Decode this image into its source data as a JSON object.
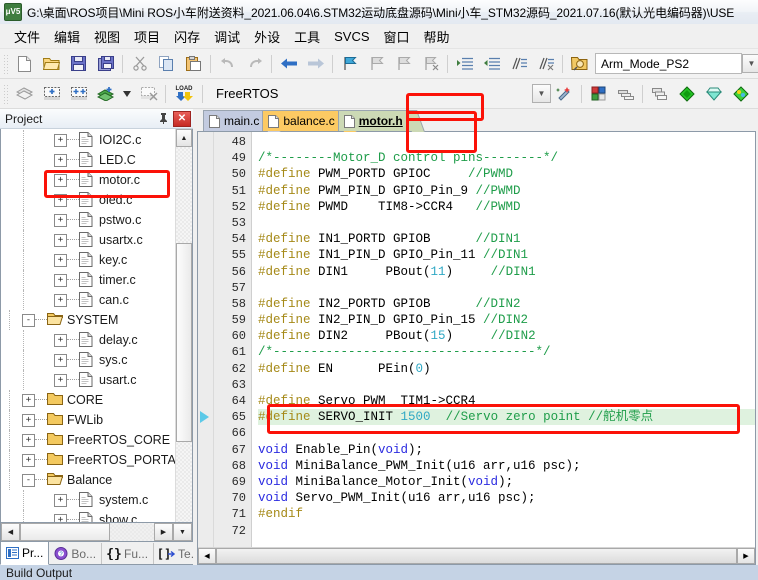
{
  "window": {
    "title": "G:\\桌面\\ROS项目\\Mini ROS小车附送资料_2021.06.04\\6.STM32运动底盘源码\\Mini小车_STM32源码_2021.07.16(默认光电编码器)\\USE",
    "app_icon": "keil-uvision-icon"
  },
  "menubar": {
    "items": [
      {
        "label": "文件",
        "name": "menu-file"
      },
      {
        "label": "编辑",
        "name": "menu-edit"
      },
      {
        "label": "视图",
        "name": "menu-view"
      },
      {
        "label": "项目",
        "name": "menu-project"
      },
      {
        "label": "闪存",
        "name": "menu-flash"
      },
      {
        "label": "调试",
        "name": "menu-debug"
      },
      {
        "label": "外设",
        "name": "menu-peripherals"
      },
      {
        "label": "工具",
        "name": "menu-tools"
      },
      {
        "label": "SVCS",
        "name": "menu-svcs"
      },
      {
        "label": "窗口",
        "name": "menu-window"
      },
      {
        "label": "帮助",
        "name": "menu-help"
      }
    ]
  },
  "toolbar_file": {
    "icons": [
      "new-file-icon",
      "open-folder-icon",
      "save-icon",
      "save-all-icon",
      "cut-icon",
      "copy-icon",
      "paste-icon",
      "undo-icon",
      "redo-icon",
      "navigate-back-icon",
      "navigate-forward-icon",
      "bookmark-toggle-icon",
      "bookmark-prev-icon",
      "bookmark-next-icon",
      "bookmark-clear-icon",
      "indent-icon",
      "outdent-icon",
      "comment-icon",
      "uncomment-icon"
    ],
    "target_label": "Arm_Mode_PS2",
    "right_icons": [
      "target-options-icon",
      "manage-components-icon",
      "debug-icon"
    ]
  },
  "toolbar_build": {
    "icons": [
      "translate-icon",
      "build-icon",
      "rebuild-icon",
      "batch-build-icon",
      "stop-build-icon",
      "download-icon"
    ],
    "target_label": "FreeRTOS",
    "right_icons": [
      "config-wizard-icon",
      "manage-project-icon",
      "multi-project-icon",
      "window-cascade-icon",
      "green-diamond-icon",
      "cyan-diamond-icon",
      "multi-diamond-icon"
    ]
  },
  "project_panel": {
    "title": "Project",
    "pin_icon": "pin-icon",
    "close_icon": "close-icon",
    "tree": [
      {
        "label": "IOI2C.c",
        "indent": 2,
        "type": "file",
        "expander": "+"
      },
      {
        "label": "LED.C",
        "indent": 2,
        "type": "file",
        "expander": "+"
      },
      {
        "label": "motor.c",
        "indent": 2,
        "type": "file",
        "expander": "+",
        "annotated": true
      },
      {
        "label": "oled.c",
        "indent": 2,
        "type": "file",
        "expander": "+"
      },
      {
        "label": "pstwo.c",
        "indent": 2,
        "type": "file",
        "expander": "+"
      },
      {
        "label": "usartx.c",
        "indent": 2,
        "type": "file",
        "expander": "+"
      },
      {
        "label": "key.c",
        "indent": 2,
        "type": "file",
        "expander": "+"
      },
      {
        "label": "timer.c",
        "indent": 2,
        "type": "file",
        "expander": "+"
      },
      {
        "label": "can.c",
        "indent": 2,
        "type": "file",
        "expander": "+"
      },
      {
        "label": "SYSTEM",
        "indent": 1,
        "type": "folder-open",
        "expander": "-"
      },
      {
        "label": "delay.c",
        "indent": 2,
        "type": "file",
        "expander": "+"
      },
      {
        "label": "sys.c",
        "indent": 2,
        "type": "file",
        "expander": "+"
      },
      {
        "label": "usart.c",
        "indent": 2,
        "type": "file",
        "expander": "+"
      },
      {
        "label": "CORE",
        "indent": 1,
        "type": "folder",
        "expander": "+"
      },
      {
        "label": "FWLib",
        "indent": 1,
        "type": "folder",
        "expander": "+"
      },
      {
        "label": "FreeRTOS_CORE",
        "indent": 1,
        "type": "folder",
        "expander": "+"
      },
      {
        "label": "FreeRTOS_PORTABLE",
        "indent": 1,
        "type": "folder",
        "expander": "+"
      },
      {
        "label": "Balance",
        "indent": 1,
        "type": "folder-open",
        "expander": "-"
      },
      {
        "label": "system.c",
        "indent": 2,
        "type": "file",
        "expander": "+"
      },
      {
        "label": "show.c",
        "indent": 2,
        "type": "file",
        "expander": "+"
      }
    ],
    "tabs": [
      {
        "label": "Pr...",
        "name": "panel-tab-project",
        "icon": "project-icon",
        "active": true
      },
      {
        "label": "Bo...",
        "name": "panel-tab-books",
        "icon": "books-icon",
        "active": false
      },
      {
        "label": "Fu...",
        "name": "panel-tab-functions",
        "icon": "braces-icon",
        "active": false
      },
      {
        "label": "Te...",
        "name": "panel-tab-templates",
        "icon": "templates-icon",
        "active": false
      }
    ]
  },
  "editor": {
    "tabs": [
      {
        "label": "main.c",
        "name": "doc-tab-main-c",
        "active": false
      },
      {
        "label": "balance.c",
        "name": "doc-tab-balance-c",
        "active": false
      },
      {
        "label": "motor.h",
        "name": "doc-tab-motor-h",
        "active": true,
        "annotated": true
      }
    ],
    "first_line": 48,
    "lines": [
      {
        "n": 48,
        "tokens": []
      },
      {
        "n": 49,
        "tokens": [
          {
            "t": "com",
            "s": "/*--------Motor_D control pins--------*/"
          }
        ]
      },
      {
        "n": 50,
        "tokens": [
          {
            "t": "pre",
            "s": "#define"
          },
          {
            "t": "pln",
            "s": " PWM_PORTD GPIOC     "
          },
          {
            "t": "com",
            "s": "//PWMD"
          }
        ]
      },
      {
        "n": 51,
        "tokens": [
          {
            "t": "pre",
            "s": "#define"
          },
          {
            "t": "pln",
            "s": " PWM_PIN_D GPIO_Pin_9 "
          },
          {
            "t": "com",
            "s": "//PWMD"
          }
        ]
      },
      {
        "n": 52,
        "tokens": [
          {
            "t": "pre",
            "s": "#define"
          },
          {
            "t": "pln",
            "s": " PWMD    TIM8->CCR4   "
          },
          {
            "t": "com",
            "s": "//PWMD"
          }
        ]
      },
      {
        "n": 53,
        "tokens": []
      },
      {
        "n": 54,
        "tokens": [
          {
            "t": "pre",
            "s": "#define"
          },
          {
            "t": "pln",
            "s": " IN1_PORTD GPIOB      "
          },
          {
            "t": "com",
            "s": "//DIN1"
          }
        ]
      },
      {
        "n": 55,
        "tokens": [
          {
            "t": "pre",
            "s": "#define"
          },
          {
            "t": "pln",
            "s": " IN1_PIN_D GPIO_Pin_11 "
          },
          {
            "t": "com",
            "s": "//DIN1"
          }
        ]
      },
      {
        "n": 56,
        "tokens": [
          {
            "t": "pre",
            "s": "#define"
          },
          {
            "t": "pln",
            "s": " DIN1     PBout("
          },
          {
            "t": "num",
            "s": "11"
          },
          {
            "t": "pln",
            "s": ")     "
          },
          {
            "t": "com",
            "s": "//DIN1"
          }
        ]
      },
      {
        "n": 57,
        "tokens": []
      },
      {
        "n": 58,
        "tokens": [
          {
            "t": "pre",
            "s": "#define"
          },
          {
            "t": "pln",
            "s": " IN2_PORTD GPIOB      "
          },
          {
            "t": "com",
            "s": "//DIN2"
          }
        ]
      },
      {
        "n": 59,
        "tokens": [
          {
            "t": "pre",
            "s": "#define"
          },
          {
            "t": "pln",
            "s": " IN2_PIN_D GPIO_Pin_15 "
          },
          {
            "t": "com",
            "s": "//DIN2"
          }
        ]
      },
      {
        "n": 60,
        "tokens": [
          {
            "t": "pre",
            "s": "#define"
          },
          {
            "t": "pln",
            "s": " DIN2     PBout("
          },
          {
            "t": "num",
            "s": "15"
          },
          {
            "t": "pln",
            "s": ")     "
          },
          {
            "t": "com",
            "s": "//DIN2"
          }
        ]
      },
      {
        "n": 61,
        "tokens": [
          {
            "t": "com",
            "s": "/*-----------------------------------*/"
          }
        ]
      },
      {
        "n": 62,
        "tokens": [
          {
            "t": "pre",
            "s": "#define"
          },
          {
            "t": "pln",
            "s": " EN      PEin("
          },
          {
            "t": "num",
            "s": "0"
          },
          {
            "t": "pln",
            "s": ")"
          }
        ]
      },
      {
        "n": 63,
        "tokens": []
      },
      {
        "n": 64,
        "tokens": [
          {
            "t": "pre",
            "s": "#define"
          },
          {
            "t": "pln",
            "s": " Servo_PWM  TIM1->CCR4"
          }
        ]
      },
      {
        "n": 65,
        "highlight": true,
        "marker": true,
        "annotated": true,
        "tokens": [
          {
            "t": "pre",
            "s": "#define"
          },
          {
            "t": "pln",
            "s": " SERVO_INIT "
          },
          {
            "t": "num",
            "s": "1500"
          },
          {
            "t": "pln",
            "s": "  "
          },
          {
            "t": "com",
            "s": "//Servo zero point //舵机零点"
          }
        ]
      },
      {
        "n": 66,
        "tokens": []
      },
      {
        "n": 67,
        "tokens": [
          {
            "t": "kw",
            "s": "void"
          },
          {
            "t": "pln",
            "s": " Enable_Pin("
          },
          {
            "t": "kw",
            "s": "void"
          },
          {
            "t": "pln",
            "s": ");"
          }
        ]
      },
      {
        "n": 68,
        "tokens": [
          {
            "t": "kw",
            "s": "void"
          },
          {
            "t": "pln",
            "s": " MiniBalance_PWM_Init(u16 arr,u16 psc);"
          }
        ]
      },
      {
        "n": 69,
        "tokens": [
          {
            "t": "kw",
            "s": "void"
          },
          {
            "t": "pln",
            "s": " MiniBalance_Motor_Init("
          },
          {
            "t": "kw",
            "s": "void"
          },
          {
            "t": "pln",
            "s": ");"
          }
        ]
      },
      {
        "n": 70,
        "tokens": [
          {
            "t": "kw",
            "s": "void"
          },
          {
            "t": "pln",
            "s": " Servo_PWM_Init(u16 arr,u16 psc);"
          }
        ]
      },
      {
        "n": 71,
        "tokens": [
          {
            "t": "pre",
            "s": "#endif"
          }
        ]
      },
      {
        "n": 72,
        "tokens": []
      }
    ]
  },
  "status": {
    "build_output": "Build Output"
  },
  "colors": {
    "annotation_red": "#fb1208",
    "highlight_line": "#dff2df",
    "comment_green": "#1f9d4a",
    "preproc_gold": "#a58917",
    "number_cyan": "#2fa8c4",
    "keyword_blue": "#2a2ae0",
    "tab_active": "#ccd9b5",
    "tab_balance": "#fcca63",
    "tab_main": "#c3cbe0"
  }
}
